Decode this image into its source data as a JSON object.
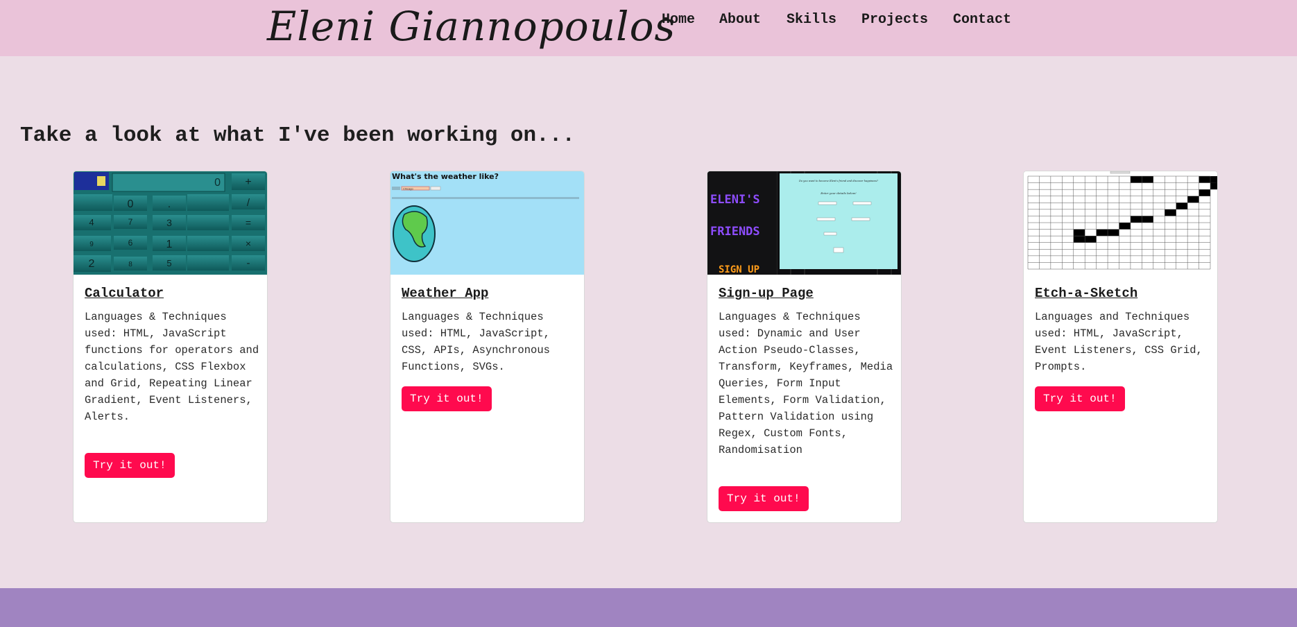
{
  "header": {
    "logo_text": "Eleni Giannopoulos",
    "nav": [
      "Home",
      "About",
      "Skills",
      "Projects",
      "Contact"
    ]
  },
  "projects_heading": "Take a look at what I've been working on...",
  "projects": [
    {
      "title": "Calculator",
      "description": "Languages & Techniques used: HTML, JavaScript functions for operators and calculations, CSS Flexbox and Grid, Repeating Linear Gradient, Event Listeners, Alerts.",
      "button": "Try it out!",
      "thumb": {
        "display": "0",
        "keys": [
          "+",
          "0",
          ".",
          "/",
          "4",
          "7",
          "3",
          "=",
          "9",
          "6",
          "1",
          "×",
          "2",
          "8",
          "5",
          "-"
        ]
      }
    },
    {
      "title": "Weather App",
      "description": "Languages & Techniques used: HTML, JavaScript, CSS, APIs, Asynchronous Functions, SVGs.",
      "button": "Try it out!",
      "thumb": {
        "heading": "What's the weather like?",
        "search_value": "Chicago"
      }
    },
    {
      "title": "Sign-up Page",
      "description": "Languages & Techniques used: Dynamic and User Action Pseudo-Classes, Transform, Keyframes, Media Queries, Form Input Elements, Form Validation, Pattern Validation using Regex, Custom Fonts, Randomisation",
      "button": "Try it out!",
      "thumb": {
        "side_line1": "ELENI'S",
        "side_line2": "FRIENDS",
        "side_line3": "SIGN UP",
        "prompt": "Do you want to become Eleni's friend and discover happiness?",
        "sub_prompt": "Enter your details below!"
      }
    },
    {
      "title": "Etch-a-Sketch",
      "description": "Languages and Techniques used: HTML, JavaScript, Event Listeners, CSS Grid, Prompts.",
      "button": "Try it out!",
      "thumb": {
        "filled_cells": [
          [
            9,
            0
          ],
          [
            10,
            0
          ],
          [
            15,
            0
          ],
          [
            16,
            0
          ],
          [
            16,
            1
          ],
          [
            15,
            2
          ],
          [
            14,
            3
          ],
          [
            13,
            4
          ],
          [
            12,
            5
          ],
          [
            9,
            6
          ],
          [
            10,
            6
          ],
          [
            8,
            7
          ],
          [
            4,
            8
          ],
          [
            6,
            8
          ],
          [
            7,
            8
          ],
          [
            4,
            9
          ],
          [
            5,
            9
          ]
        ]
      }
    }
  ],
  "colors": {
    "page_background": "#ecdde6",
    "header_background": "#eac3d9",
    "footer_background": "#a084c1",
    "button": "#ff0a4e"
  }
}
